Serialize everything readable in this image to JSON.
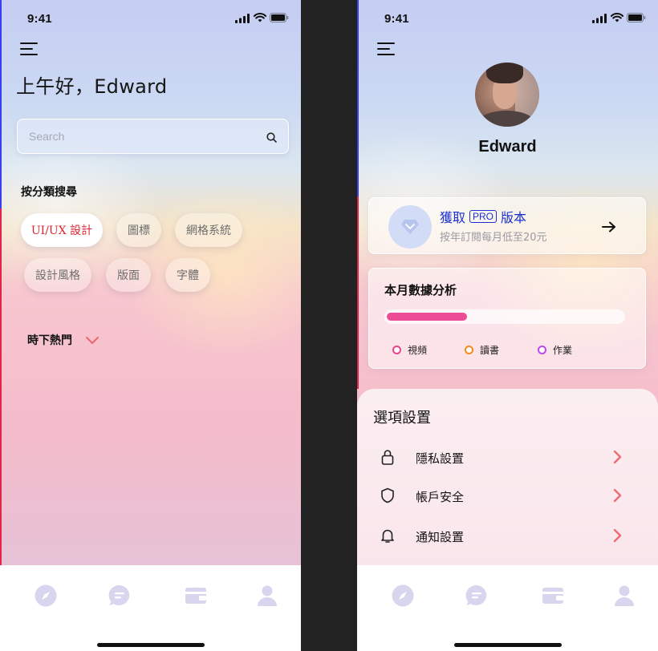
{
  "status_bar": {
    "time": "9:41"
  },
  "home": {
    "greeting": "上午好，Edward",
    "search": {
      "placeholder": "Search"
    },
    "categories_label": "按分類搜尋",
    "categories": [
      {
        "label": "UI/UX 設計",
        "active": true
      },
      {
        "label": "圖標",
        "active": false
      },
      {
        "label": "網格系統",
        "active": false
      },
      {
        "label": "設計風格",
        "active": false
      },
      {
        "label": "版面",
        "active": false
      },
      {
        "label": "字體",
        "active": false
      }
    ],
    "trending_label": "時下熱門"
  },
  "profile": {
    "name": "Edward",
    "pro_card": {
      "title_prefix": "獲取",
      "badge": "PRO",
      "title_suffix": "版本",
      "subtitle": "按年訂閱每月低至20元",
      "icon": "diamond-icon"
    },
    "stats": {
      "title": "本月數據分析",
      "progress": 0.34,
      "legend": [
        {
          "label": "視頻",
          "color": "#e8438f"
        },
        {
          "label": "讀書",
          "color": "#f28a1e"
        },
        {
          "label": "作業",
          "color": "#b84ae8"
        }
      ]
    },
    "settings": {
      "title": "選項設置",
      "items": [
        {
          "label": "隱私設置",
          "icon": "lock-icon"
        },
        {
          "label": "帳戶安全",
          "icon": "shield-icon"
        },
        {
          "label": "通知設置",
          "icon": "bell-icon"
        }
      ]
    }
  },
  "tab_bar": {
    "icons": [
      "compass-icon",
      "chat-icon",
      "wallet-icon",
      "user-icon"
    ],
    "icon_color": "#d8d5ef"
  },
  "colors": {
    "accent_red": "#e0242f",
    "accent_blue": "#1c2fd3",
    "chevron": "#ef6a73",
    "progress": "#ec4b95"
  }
}
